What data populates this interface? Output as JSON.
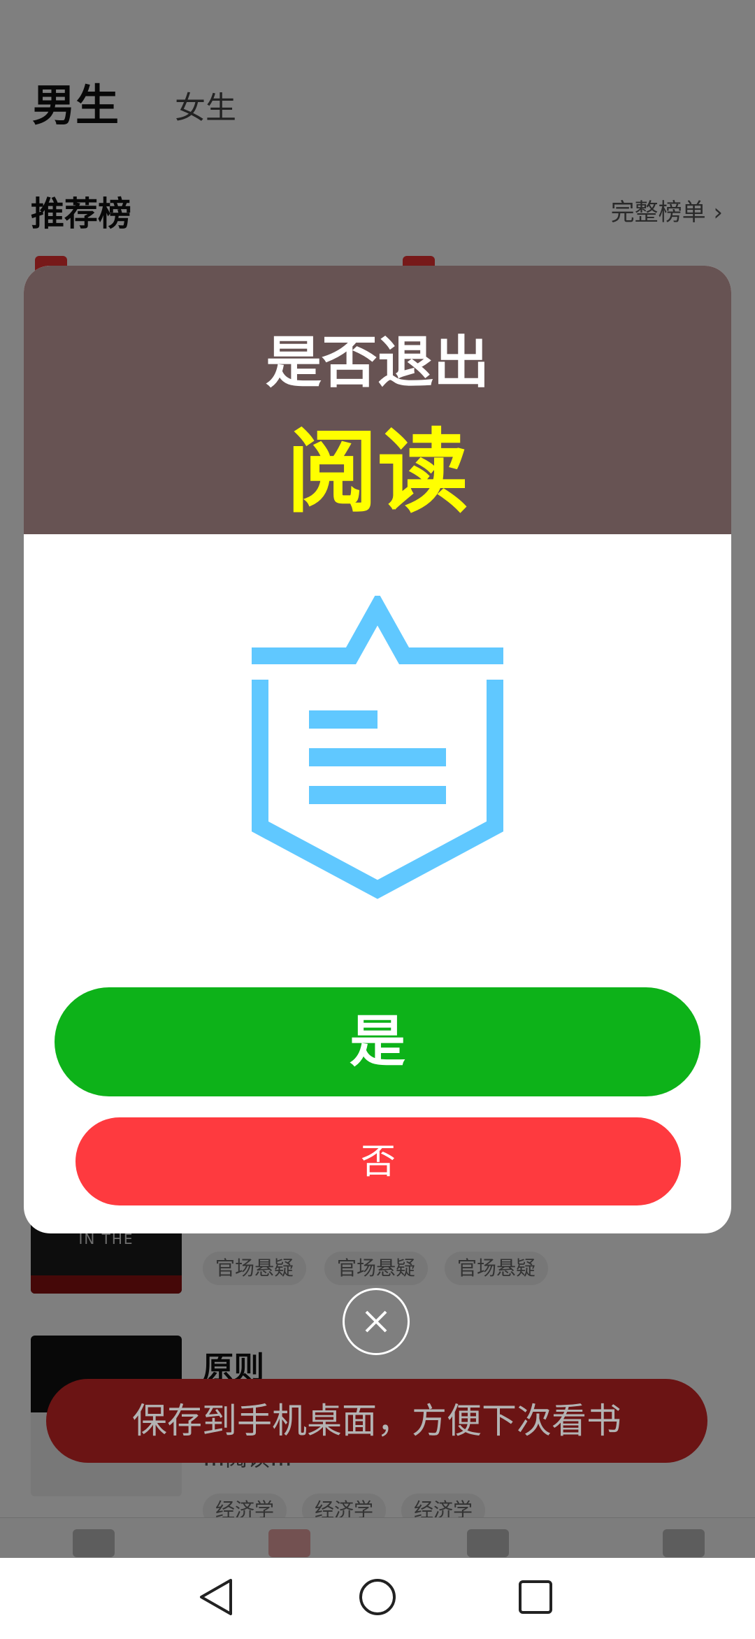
{
  "top_tabs": {
    "male": "男生",
    "female": "女生"
  },
  "section": {
    "title": "推荐榜",
    "full_list": "完整榜单 ›"
  },
  "books": [
    {
      "cover_text": "IN THE",
      "tags": [
        "官场悬疑",
        "官场悬疑",
        "官场悬疑"
      ]
    },
    {
      "title": "原则",
      "desc": "…阅读…",
      "tags": [
        "经济学",
        "经济学",
        "经济学"
      ]
    }
  ],
  "dialog": {
    "title": "是否退出",
    "highlight": "阅读",
    "icon": "shield-document-icon",
    "yes_label": "是",
    "no_label": "否"
  },
  "close_icon": "close-icon",
  "save_banner": "保存到手机桌面，方便下次看书",
  "navbar": {
    "back": "back-triangle-icon",
    "home": "home-circle-icon",
    "recents": "recents-square-icon"
  },
  "colors": {
    "header_bg": "#675353",
    "highlight": "#ffff00",
    "yes_button": "#0db219",
    "no_button": "#fe3a3f",
    "icon_blue": "#60c8ff",
    "banner": "#6b1414"
  }
}
